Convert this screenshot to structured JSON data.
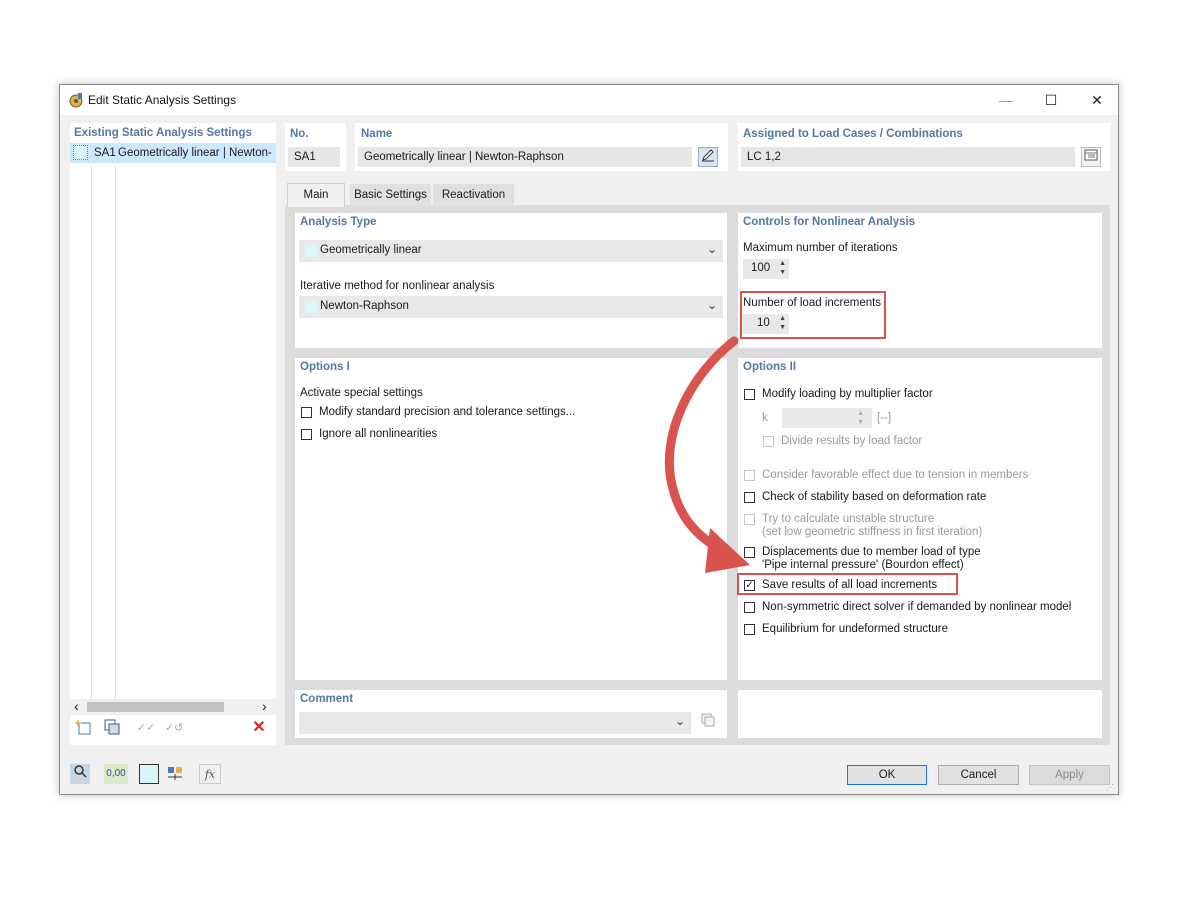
{
  "window": {
    "title": "Edit Static Analysis Settings",
    "minimize": "—",
    "maximize": "☐",
    "close": "✕"
  },
  "left_panel": {
    "title": "Existing Static Analysis Settings",
    "items": [
      {
        "no": "SA1",
        "label": "Geometrically linear | Newton-"
      }
    ],
    "scroll_left": "‹",
    "scroll_right": "›",
    "delete_icon": "✕"
  },
  "header": {
    "no_label": "No.",
    "no_value": "SA1",
    "name_label": "Name",
    "name_value": "Geometrically linear | Newton-Raphson",
    "assigned_label": "Assigned to Load Cases / Combinations",
    "assigned_value": "LC 1,2"
  },
  "tabs": [
    {
      "label": "Main",
      "active": true
    },
    {
      "label": "Basic Settings"
    },
    {
      "label": "Reactivation"
    }
  ],
  "analysis_type": {
    "title": "Analysis Type",
    "type_value": "Geometrically linear",
    "method_label": "Iterative method for nonlinear analysis",
    "method_value": "Newton-Raphson"
  },
  "controls": {
    "title": "Controls for Nonlinear Analysis",
    "max_iter_label": "Maximum number of iterations",
    "max_iter_value": "100",
    "load_inc_label": "Number of load increments",
    "load_inc_value": "10"
  },
  "options1": {
    "title": "Options I",
    "activate_label": "Activate special settings",
    "items": [
      "Modify standard precision and tolerance settings...",
      "Ignore all nonlinearities"
    ]
  },
  "options2": {
    "title": "Options II",
    "modify_loading": "Modify loading by multiplier factor",
    "k_label": "k",
    "k_unit": "[--]",
    "divide_results": "Divide results by load factor",
    "favorable": "Consider favorable effect due to tension in members",
    "stability": "Check of stability based on deformation rate",
    "unstable_1": "Try to calculate unstable structure",
    "unstable_2": "(set low geometric stiffness in first iteration)",
    "displ_1": "Displacements due to member load of type",
    "displ_2": "'Pipe internal pressure' (Bourdon effect)",
    "save_results": "Save results of all load increments",
    "nonsym": "Non-symmetric direct solver if demanded by nonlinear model",
    "equilibrium": "Equilibrium for undeformed structure"
  },
  "comment": {
    "title": "Comment"
  },
  "footer": {
    "ok": "OK",
    "cancel": "Cancel",
    "apply": "Apply",
    "zero_icon": "0,00",
    "fx_icon": "fx"
  },
  "colors": {
    "accent": "#5577a2",
    "highlight": "#d9534f",
    "selection": "#cce8ff",
    "swatch": "#d9f7fb"
  }
}
